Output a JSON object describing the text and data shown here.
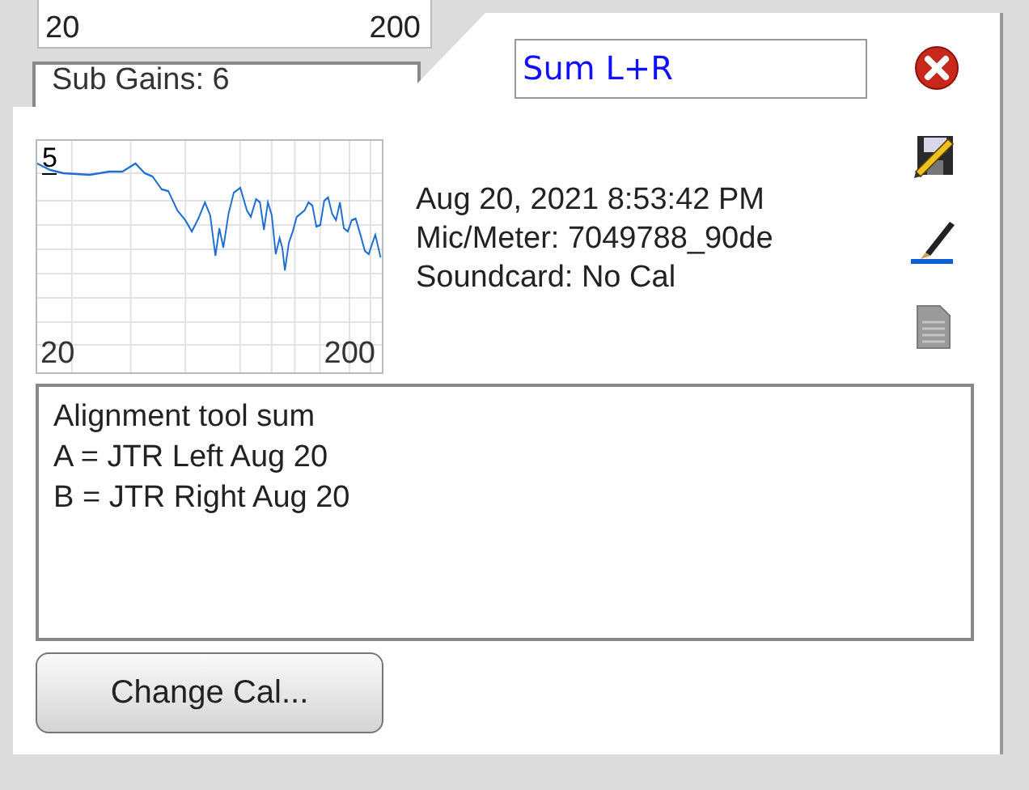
{
  "back_card": {
    "chart_x_min": "20",
    "chart_x_max": "200",
    "sub_gains": "Sub Gains: 6"
  },
  "name_field": {
    "value": "Sum L+R"
  },
  "chart": {
    "y_label": "5",
    "x_min": "20",
    "x_max": "200"
  },
  "info": [
    "Aug 20, 2021 8:53:42 PM",
    "Mic/Meter: 7049788_90de",
    "Soundcard: No Cal"
  ],
  "notes": [
    "Alignment tool sum",
    "A = JTR Left Aug 20",
    "B = JTR Right Aug 20"
  ],
  "buttons": [
    "Change Cal..."
  ]
}
